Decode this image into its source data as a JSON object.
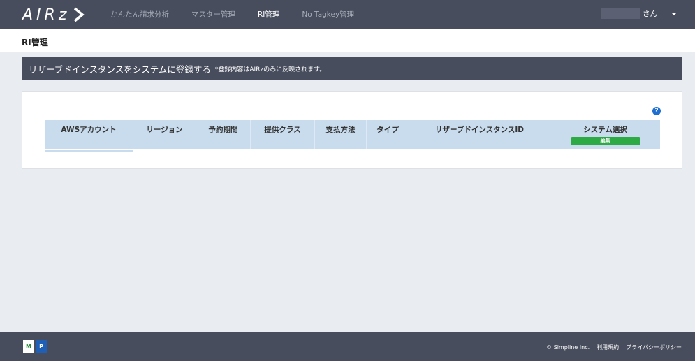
{
  "logo": {
    "text": "AIRz"
  },
  "nav": {
    "items": [
      {
        "label": "かんたん請求分析",
        "active": false
      },
      {
        "label": "マスター管理",
        "active": false
      },
      {
        "label": "RI管理",
        "active": true
      },
      {
        "label": "No Tagkey管理",
        "active": false
      }
    ]
  },
  "user": {
    "suffix": "さん"
  },
  "page": {
    "title": "RI管理"
  },
  "banner": {
    "title": "リザーブドインスタンスをシステムに登録する",
    "note": "*登録内容はAIRzのみに反映されます。"
  },
  "table": {
    "help_icon": "?",
    "columns": [
      "AWSアカウント",
      "リージョン",
      "予約期間",
      "提供クラス",
      "支払方法",
      "タイプ",
      "リザーブドインスタンスID",
      "システム選択"
    ],
    "edit_label": "編集"
  },
  "footer": {
    "copyright": "© Simpline Inc.",
    "terms": "利用規約",
    "privacy": "プライバシーポリシー",
    "badge_a": "M",
    "badge_b": "P"
  },
  "colors": {
    "nav_bg": "#474d5d",
    "page_bg": "#e9ecf1",
    "table_header_bg": "#c8dcee",
    "edit_button": "#2eaa44",
    "help_icon": "#1f6fd1"
  }
}
